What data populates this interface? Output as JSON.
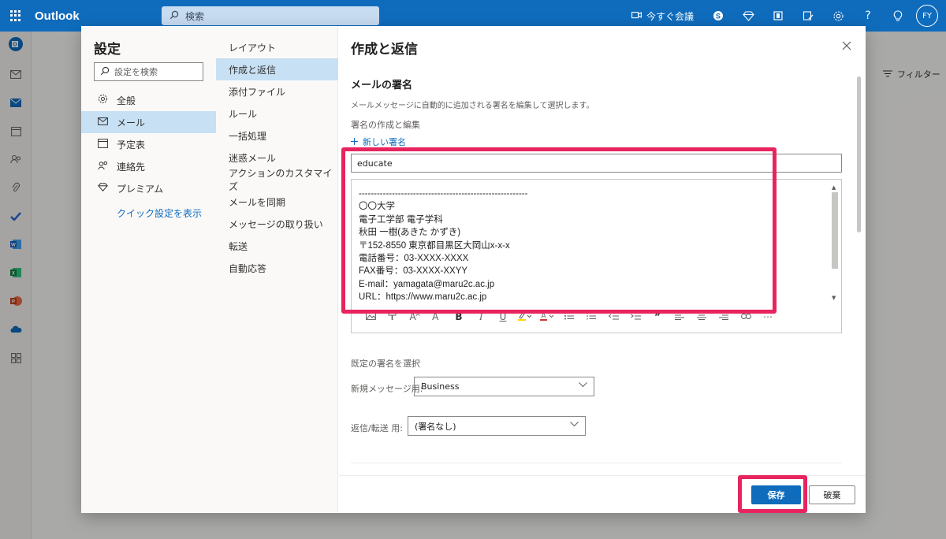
{
  "topbar": {
    "app_name": "Outlook",
    "search_placeholder": "検索",
    "meet_now": "今すぐ会議",
    "avatar_initials": "FY",
    "brand_color": "#0f6cbd"
  },
  "background": {
    "filter_label": "フィルター"
  },
  "settings": {
    "title": "設定",
    "search_placeholder": "設定を検索",
    "categories": [
      {
        "label": "全般",
        "icon": "gear-icon"
      },
      {
        "label": "メール",
        "icon": "mail-icon"
      },
      {
        "label": "予定表",
        "icon": "calendar-icon"
      },
      {
        "label": "連絡先",
        "icon": "people-icon"
      },
      {
        "label": "プレミアム",
        "icon": "diamond-icon"
      }
    ],
    "active_category": "メール",
    "quick_settings": "クイック設定を表示"
  },
  "mail_subsections": [
    "レイアウト",
    "作成と返信",
    "添付ファイル",
    "ルール",
    "一括処理",
    "迷惑メール",
    "アクションのカスタマイズ",
    "メールを同期",
    "メッセージの取り扱い",
    "転送",
    "自動応答"
  ],
  "active_subsection": "作成と返信",
  "compose": {
    "title": "作成と返信",
    "section_title": "メールの署名",
    "description": "メールメッセージに自動的に追加される署名を編集して選択します。",
    "create_edit_label": "署名の作成と編集",
    "new_signature": "新しい署名",
    "signature_name": "educate",
    "signature_lines": [
      "--------------------------------------------------------",
      "〇〇大学",
      "電子工学部 電子学科",
      "秋田 一樹(あきた かずき)",
      "〒152-8550 東京都目黒区大岡山x-x-x",
      "電話番号：03-XXXX-XXXX",
      "FAX番号：03-XXXX-XXYY",
      "E-mail：yamagata@maru2c.ac.jp",
      "URL：https://www.maru2c.ac.jp"
    ],
    "default_signature_label": "既定の署名を選択",
    "new_message_label": "新規メッセージ用:",
    "new_message_value": "Business",
    "reply_label": "返信/転送 用:",
    "reply_value": "(署名なし)"
  },
  "footer": {
    "save": "保存",
    "discard": "破棄"
  },
  "highlight_color": "#e8245f"
}
